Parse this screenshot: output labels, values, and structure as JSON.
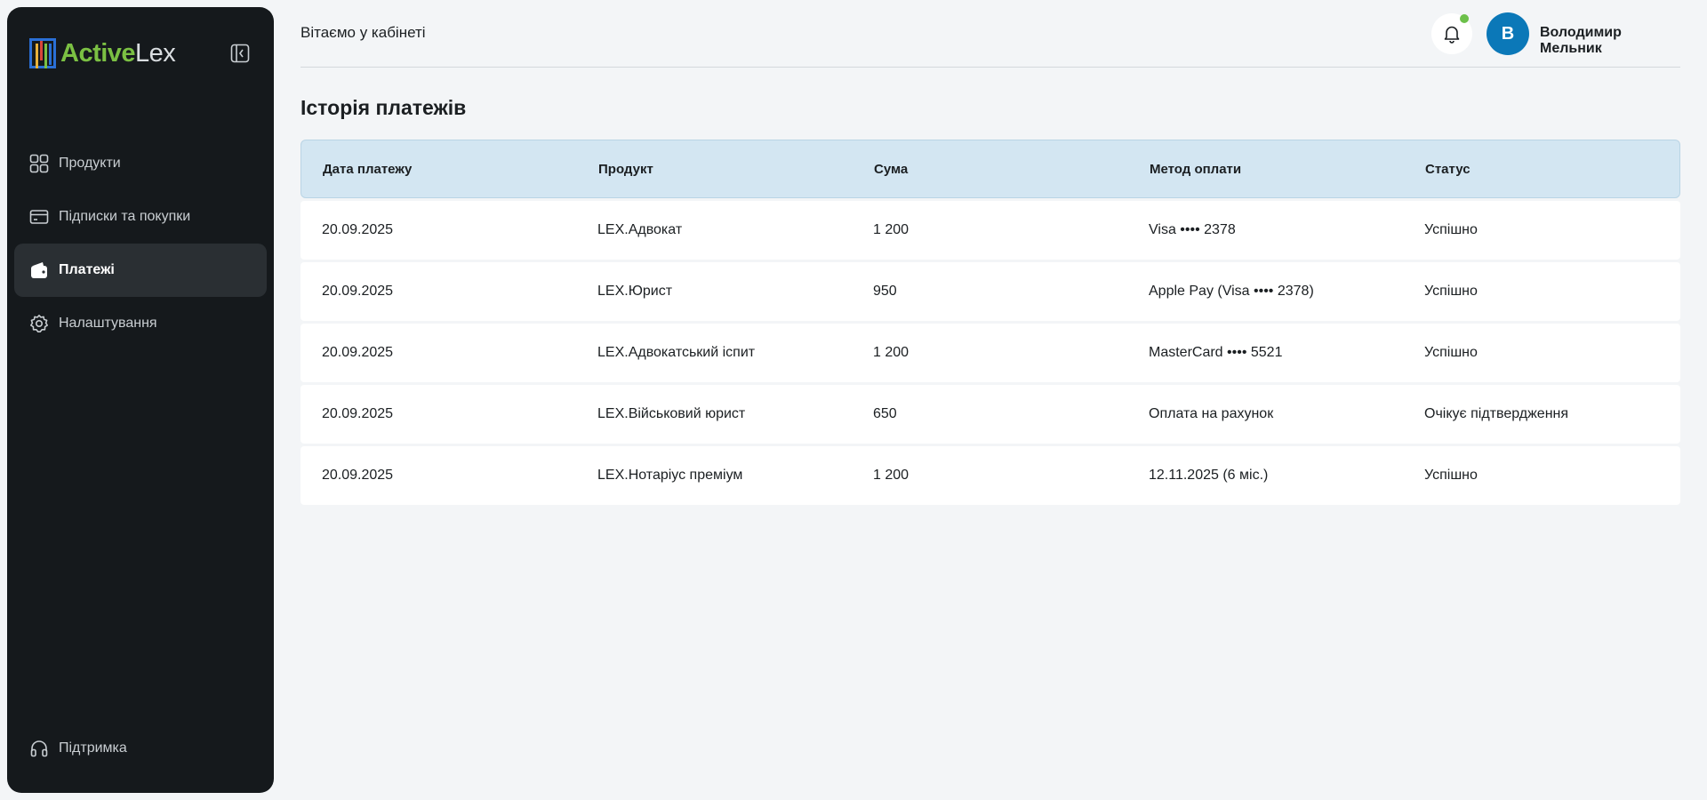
{
  "brand": {
    "name_part1": "Active",
    "name_part2": "Lex",
    "color_active": "#7bc043"
  },
  "sidebar": {
    "items": [
      {
        "label": "Продукти",
        "icon": "grid-icon"
      },
      {
        "label": "Підписки та покупки",
        "icon": "card-icon"
      },
      {
        "label": "Платежі",
        "icon": "wallet-icon",
        "active": true
      },
      {
        "label": "Налаштування",
        "icon": "gear-icon"
      }
    ],
    "support_label": "Підтримка"
  },
  "header": {
    "greeting": "Вітаємо у кабінеті",
    "user_initial": "В",
    "user_name": "Володимир Мельник",
    "notification_dot_color": "#6cc04a"
  },
  "page": {
    "title": "Історія платежів"
  },
  "table": {
    "columns": [
      "Дата платежу",
      "Продукт",
      "Сума",
      "Метод оплати",
      "Статус"
    ],
    "rows": [
      [
        "20.09.2025",
        "LEX.Адвокат",
        "1 200",
        "Visa •••• 2378",
        "Успішно"
      ],
      [
        "20.09.2025",
        "LEX.Юрист",
        "950",
        "Apple Pay (Visa •••• 2378)",
        "Успішно"
      ],
      [
        "20.09.2025",
        "LEX.Адвокатський іспит",
        "1 200",
        "MasterCard •••• 5521",
        "Успішно"
      ],
      [
        "20.09.2025",
        "LEX.Військовий юрист",
        "650",
        "Оплата на рахунок",
        "Очікує підтвердження"
      ],
      [
        "20.09.2025",
        "LEX.Нотаріус преміум",
        "1 200",
        "12.11.2025 (6 міс.)",
        "Успішно"
      ]
    ]
  }
}
